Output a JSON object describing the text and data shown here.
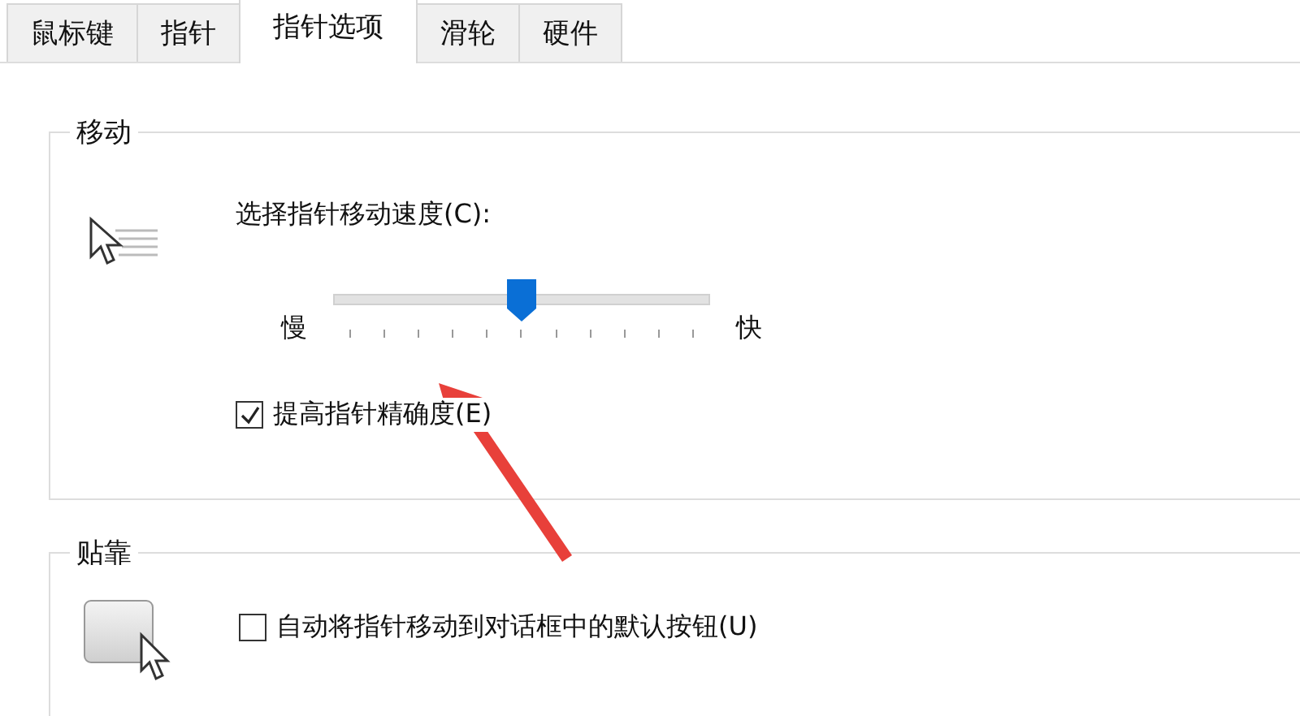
{
  "tabs": [
    {
      "label": "鼠标键",
      "selected": false
    },
    {
      "label": "指针",
      "selected": false
    },
    {
      "label": "指针选项",
      "selected": true
    },
    {
      "label": "滑轮",
      "selected": false
    },
    {
      "label": "硬件",
      "selected": false
    }
  ],
  "motion": {
    "title": "移动",
    "speed_label": "选择指针移动速度(C):",
    "slow_label": "慢",
    "fast_label": "快",
    "level": 0.5,
    "precision": {
      "label": "提高指针精确度(E)",
      "checked": true
    }
  },
  "snap_to": {
    "title": "贴靠",
    "option": {
      "label": "自动将指针移动到对话框中的默认按钮(U)",
      "checked": false
    }
  }
}
